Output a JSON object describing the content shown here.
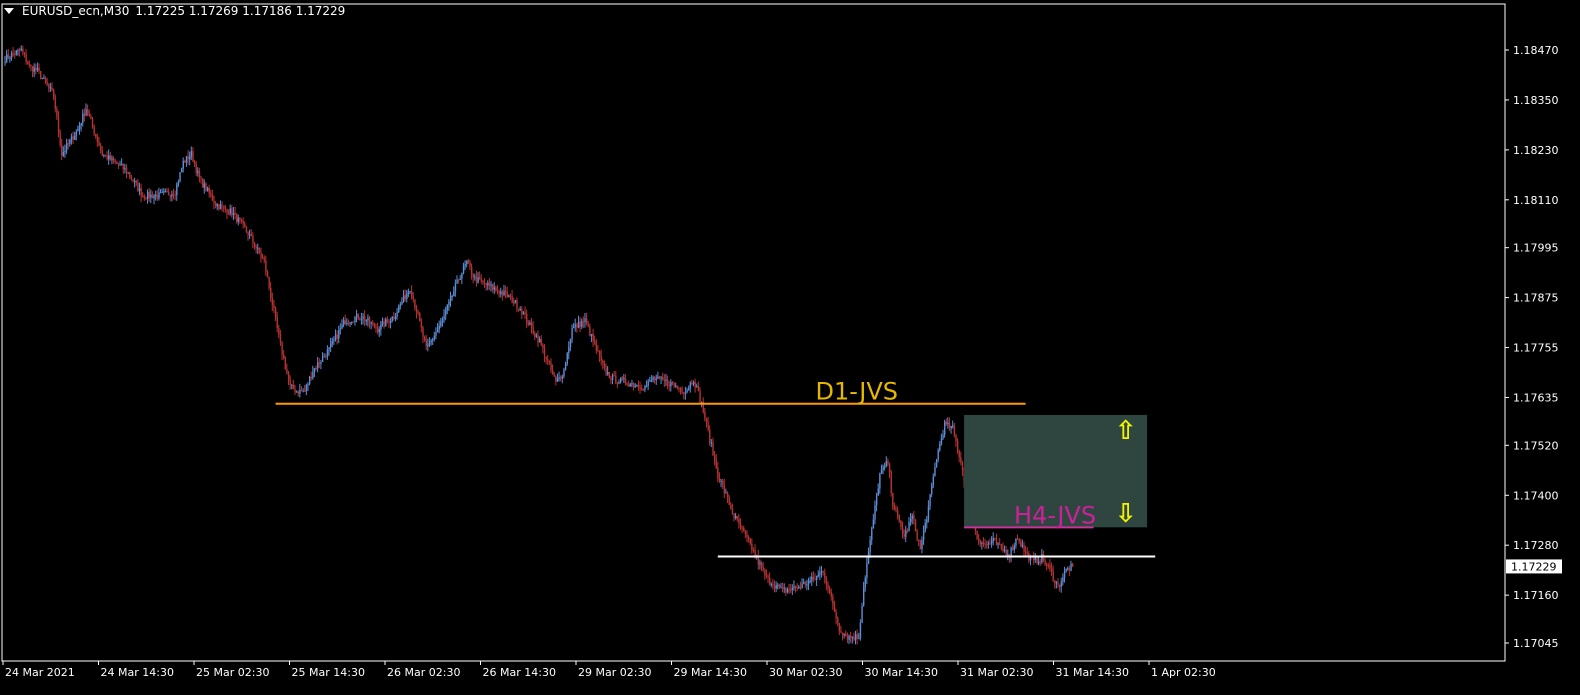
{
  "header": {
    "symbol_timeframe": "EURUSD_ecn,M30",
    "ohlc": "1.17225 1.17269 1.17186 1.17229"
  },
  "chart_data": {
    "type": "candlestick",
    "symbol": "EURUSD_ecn",
    "timeframe": "M30",
    "y_ticks": [
      "1.18470",
      "1.18350",
      "1.18230",
      "1.18110",
      "1.17995",
      "1.17875",
      "1.17755",
      "1.17635",
      "1.17520",
      "1.17400",
      "1.17280",
      "1.17160",
      "1.17045"
    ],
    "x_ticks": [
      "24 Mar 2021",
      "24 Mar 14:30",
      "25 Mar 02:30",
      "25 Mar 14:30",
      "26 Mar 02:30",
      "26 Mar 14:30",
      "29 Mar 02:30",
      "29 Mar 14:30",
      "30 Mar 02:30",
      "30 Mar 14:30",
      "31 Mar 02:30",
      "31 Mar 14:30",
      "1 Apr 02:30"
    ],
    "ylim": [
      1.1703,
      1.185
    ],
    "current_price": "1.17229",
    "anchors": [
      [
        0,
        1.1845
      ],
      [
        10,
        1.1847
      ],
      [
        15,
        1.1843
      ],
      [
        20,
        1.1842
      ],
      [
        30,
        1.1836
      ],
      [
        35,
        1.1822
      ],
      [
        45,
        1.1828
      ],
      [
        50,
        1.1833
      ],
      [
        60,
        1.1822
      ],
      [
        75,
        1.1818
      ],
      [
        85,
        1.1812
      ],
      [
        95,
        1.1812
      ],
      [
        105,
        1.1813
      ],
      [
        110,
        1.182
      ],
      [
        115,
        1.1822
      ],
      [
        120,
        1.1816
      ],
      [
        130,
        1.181
      ],
      [
        140,
        1.1808
      ],
      [
        150,
        1.1803
      ],
      [
        160,
        1.1796
      ],
      [
        170,
        1.1776
      ],
      [
        176,
        1.1766
      ],
      [
        180,
        1.1765
      ],
      [
        185,
        1.1765
      ],
      [
        190,
        1.177
      ],
      [
        200,
        1.1775
      ],
      [
        210,
        1.1782
      ],
      [
        220,
        1.1783
      ],
      [
        230,
        1.178
      ],
      [
        240,
        1.1783
      ],
      [
        250,
        1.179
      ],
      [
        255,
        1.1783
      ],
      [
        260,
        1.1775
      ],
      [
        270,
        1.1782
      ],
      [
        280,
        1.1792
      ],
      [
        285,
        1.1796
      ],
      [
        290,
        1.1792
      ],
      [
        300,
        1.179
      ],
      [
        310,
        1.1788
      ],
      [
        318,
        1.1785
      ],
      [
        325,
        1.178
      ],
      [
        330,
        1.1777
      ],
      [
        340,
        1.1767
      ],
      [
        345,
        1.177
      ],
      [
        350,
        1.178
      ],
      [
        358,
        1.1782
      ],
      [
        365,
        1.1775
      ],
      [
        370,
        1.177
      ],
      [
        375,
        1.1768
      ],
      [
        385,
        1.1767
      ],
      [
        395,
        1.1766
      ],
      [
        400,
        1.1768
      ],
      [
        410,
        1.1767
      ],
      [
        420,
        1.1765
      ],
      [
        425,
        1.1768
      ],
      [
        430,
        1.1762
      ],
      [
        440,
        1.1745
      ],
      [
        450,
        1.1735
      ],
      [
        460,
        1.1728
      ],
      [
        470,
        1.172
      ],
      [
        480,
        1.1717
      ],
      [
        490,
        1.1718
      ],
      [
        500,
        1.172
      ],
      [
        505,
        1.1722
      ],
      [
        510,
        1.1715
      ],
      [
        515,
        1.1708
      ],
      [
        520,
        1.1706
      ],
      [
        527,
        1.1706
      ],
      [
        530,
        1.1718
      ],
      [
        540,
        1.1745
      ],
      [
        545,
        1.1748
      ],
      [
        548,
        1.1738
      ],
      [
        555,
        1.173
      ],
      [
        560,
        1.1735
      ],
      [
        565,
        1.1727
      ],
      [
        570,
        1.1737
      ],
      [
        575,
        1.1749
      ],
      [
        580,
        1.1757
      ],
      [
        585,
        1.1756
      ],
      [
        590,
        1.1748
      ],
      [
        595,
        1.1738
      ],
      [
        600,
        1.173
      ],
      [
        605,
        1.1728
      ],
      [
        610,
        1.1729
      ],
      [
        615,
        1.1727
      ],
      [
        620,
        1.1726
      ],
      [
        625,
        1.173
      ],
      [
        630,
        1.1726
      ],
      [
        635,
        1.1724
      ],
      [
        640,
        1.1725
      ],
      [
        645,
        1.1722
      ],
      [
        650,
        1.1718
      ],
      [
        655,
        1.1722
      ],
      [
        659,
        1.1723
      ]
    ],
    "levels": [
      {
        "label": "D1-JVS",
        "price": 1.1762,
        "color": "#ff9900",
        "text_color": "#e6b800",
        "from_bar": 167,
        "to_bar": 630
      },
      {
        "label": "H4-JVS",
        "price": 1.17323,
        "color": "#cc3399",
        "text_color": "#cc2299",
        "from_bar": 592,
        "to_bar": 672
      },
      {
        "label": "",
        "price": 1.17253,
        "color": "#ffffff",
        "text_color": "#ffffff",
        "from_bar": 440,
        "to_bar": 710
      }
    ],
    "zone": {
      "color": "#2e4540",
      "price_top": 1.17593,
      "price_bottom": 1.17323,
      "from_bar": 592,
      "to_bar": 705
    },
    "arrows": [
      {
        "name": "up-arrow-icon",
        "glyph": "⇧",
        "color": "#f5f500",
        "price": 1.17555,
        "bar": 690
      },
      {
        "name": "down-arrow-icon",
        "glyph": "⇩",
        "color": "#f5f500",
        "price": 1.17355,
        "bar": 690
      }
    ],
    "bull_color": "#5b8ed6",
    "bear_color": "#b83232",
    "grid": false,
    "legend": "none"
  }
}
